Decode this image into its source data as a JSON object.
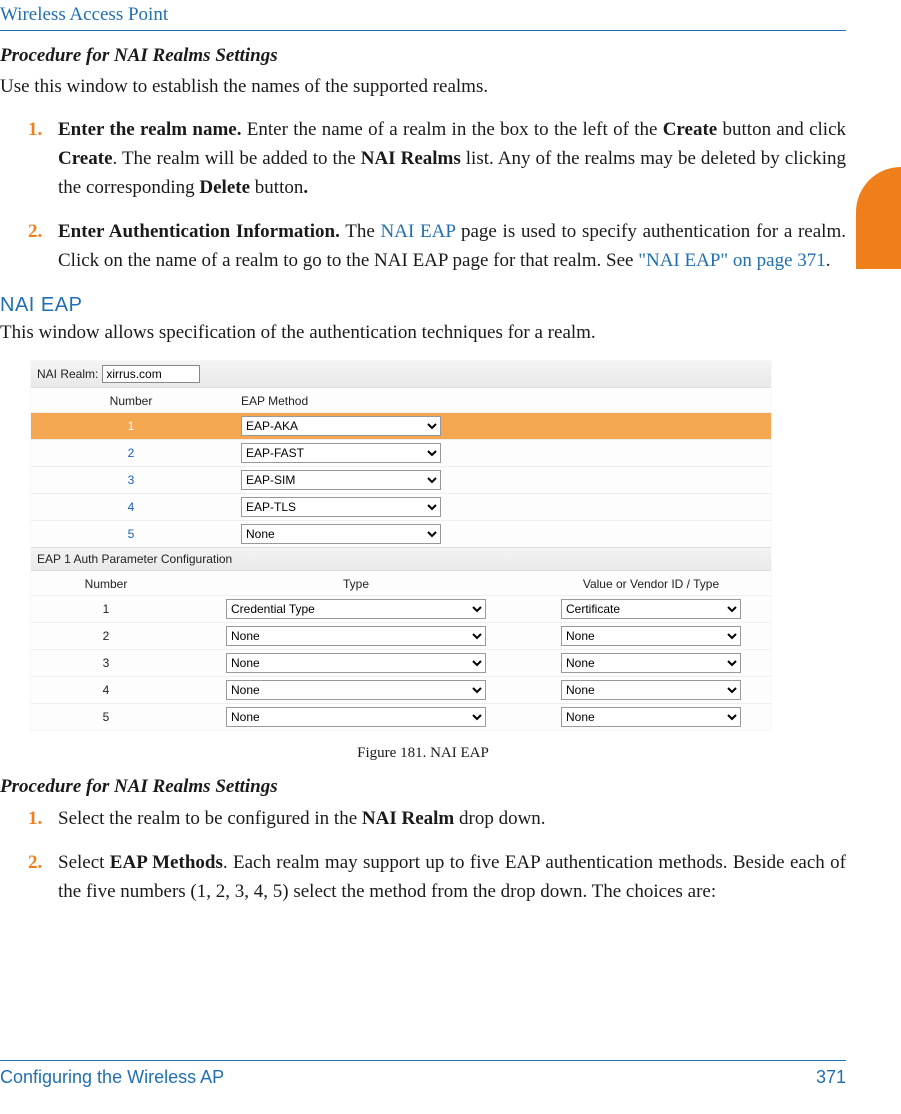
{
  "header": {
    "title": "Wireless Access Point"
  },
  "proc1": {
    "heading": "Procedure for NAI Realms Settings",
    "intro": "Use this window to establish the names of the supported realms.",
    "step1": {
      "num": "1.",
      "lead": "Enter the realm name.",
      "t1": " Enter the name of a realm in the box to the left of the ",
      "b1": "Create",
      "t2": " button and click ",
      "b2": "Create",
      "t3": ". The realm will be added to the ",
      "b3": "NAI Realms",
      "t4": " list. Any of the realms may be deleted by clicking the corresponding ",
      "b4": "Delete",
      "t5": " button",
      "b5": "."
    },
    "step2": {
      "num": "2.",
      "lead": "Enter Authentication Information.",
      "t1": " The ",
      "l1": "NAI EAP",
      "t2": " page is used to specify authentication for a realm. Click on the name of a realm to go to the NAI EAP page for that realm. See ",
      "l2": "\"NAI EAP\" on page 371",
      "t3": "."
    }
  },
  "section": {
    "title": "NAI EAP"
  },
  "section_intro": "This window allows specification of the authentication techniques for a realm.",
  "figure": {
    "realm_label": "NAI Realm:",
    "realm_value": "xirrus.com",
    "eap_headers": {
      "num": "Number",
      "method": "EAP Method"
    },
    "eap_rows": [
      {
        "n": "1",
        "v": "EAP-AKA"
      },
      {
        "n": "2",
        "v": "EAP-FAST"
      },
      {
        "n": "3",
        "v": "EAP-SIM"
      },
      {
        "n": "4",
        "v": "EAP-TLS"
      },
      {
        "n": "5",
        "v": "None"
      }
    ],
    "subheader": "EAP 1 Auth Parameter Configuration",
    "param_headers": {
      "num": "Number",
      "type": "Type",
      "value": "Value or Vendor ID / Type"
    },
    "param_rows": [
      {
        "n": "1",
        "t": "Credential Type",
        "v": "Certificate"
      },
      {
        "n": "2",
        "t": "None",
        "v": "None"
      },
      {
        "n": "3",
        "t": "None",
        "v": "None"
      },
      {
        "n": "4",
        "t": "None",
        "v": "None"
      },
      {
        "n": "5",
        "t": "None",
        "v": "None"
      }
    ],
    "caption": "Figure 181. NAI EAP"
  },
  "proc2": {
    "heading": "Procedure for NAI Realms Settings",
    "step1": {
      "num": "1.",
      "t1": "Select the realm to be configured in the ",
      "b1": "NAI Realm",
      "t2": " drop down."
    },
    "step2": {
      "num": "2.",
      "t1": "Select ",
      "b1": "EAP Methods",
      "t2": ". Each realm may support up to five EAP authentication methods. Beside each of the five numbers (1, 2, 3, 4, 5) select the method from the drop down. The choices are:"
    }
  },
  "footer": {
    "left": "Configuring the Wireless AP",
    "right": "371"
  }
}
